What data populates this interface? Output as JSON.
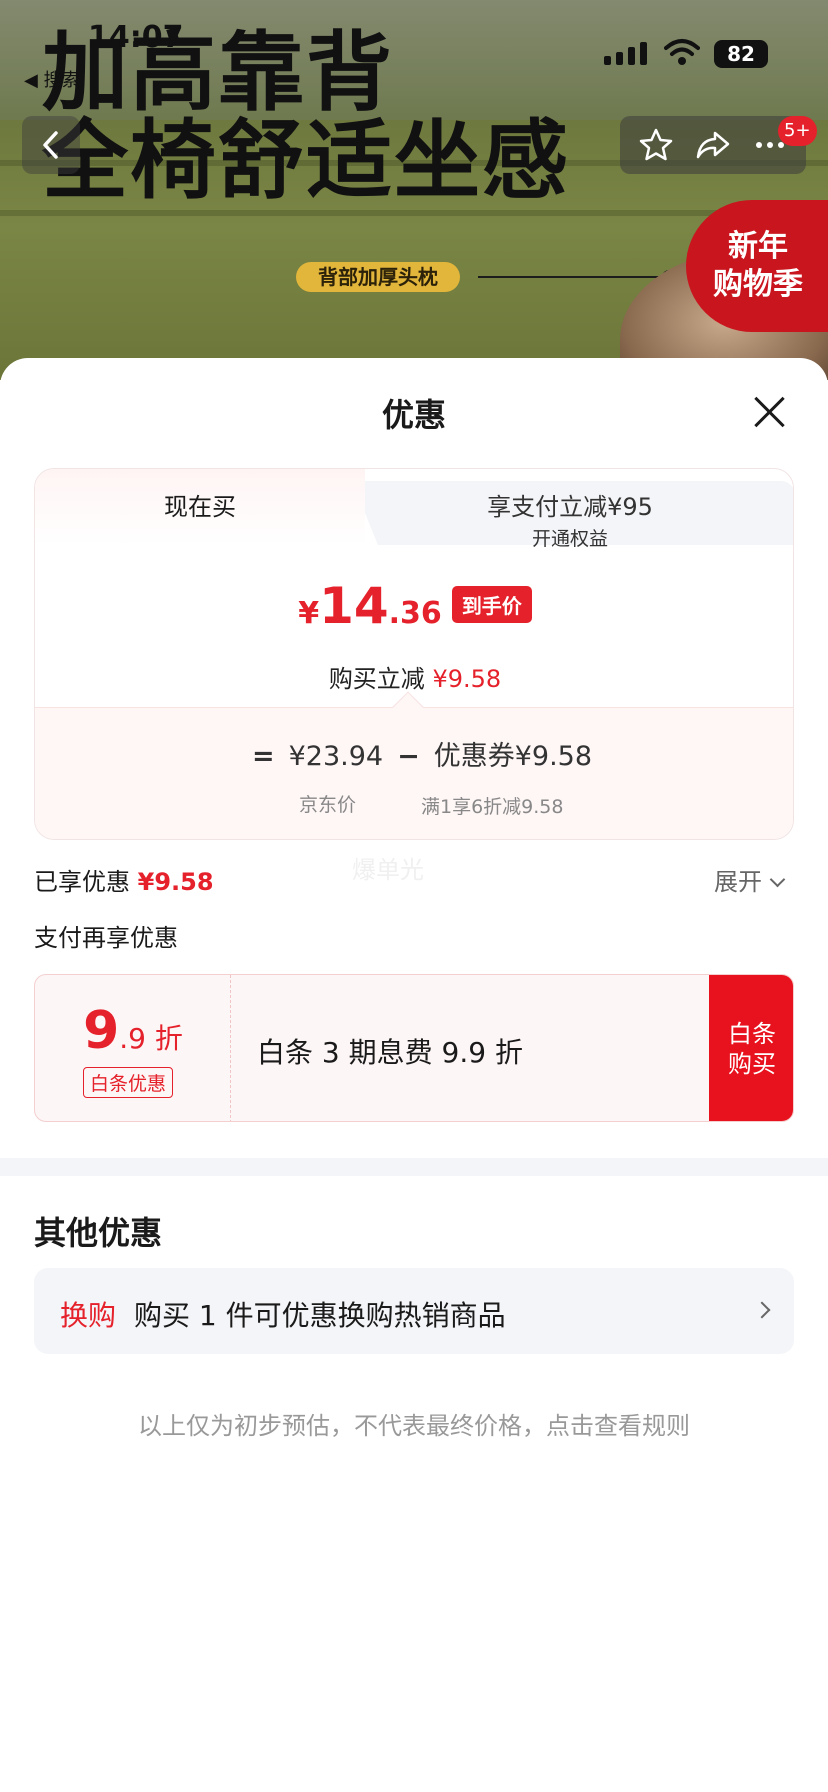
{
  "status_bar": {
    "time": "14:07",
    "back_label": "◀ 搜索",
    "battery": "82"
  },
  "banner": {
    "headline_line1": "加高靠背",
    "headline_line2": "全椅舒适坐感",
    "feature_pill": "背部加厚头枕",
    "promo_line1": "新年",
    "promo_line2": "购物季",
    "cart_badge": "5+"
  },
  "sheet": {
    "title": "优惠",
    "tabs": {
      "now": "现在买",
      "pay_title": "享支付立减¥95",
      "pay_sub": "开通权益"
    },
    "final_price": {
      "currency": "¥",
      "integer": "14",
      "decimal": ".36",
      "tag": "到手价"
    },
    "reduce": {
      "label": "购买立减",
      "amount": "¥9.58"
    },
    "formula": {
      "equals": "=",
      "jd_price": "¥23.94",
      "minus": "−",
      "coupon": "优惠券¥9.58",
      "jd_price_label": "京东价",
      "coupon_rule": "满1享6折减9.58"
    },
    "watermark": "爆单光",
    "enjoyed": {
      "label": "已享优惠",
      "amount": "¥9.58",
      "expand": "展开"
    },
    "pay_more_label": "支付再享优惠",
    "baitiao": {
      "rate_big": "9",
      "rate_small": ".9 折",
      "tag": "白条优惠",
      "desc": "白条 3 期息费 9.9 折",
      "button_line1": "白条",
      "button_line2": "购买"
    },
    "other": {
      "title": "其他优惠",
      "item_tag": "换购",
      "item_text": "购买 1 件可优惠换购热销商品"
    },
    "note": "以上仅为初步预估，不代表最终价格，点击查看规则"
  },
  "colors": {
    "accent_red": "#e5212b",
    "button_red": "#e8121e",
    "gray_bg": "#f4f5f8"
  },
  "icons": [
    "back-arrow-icon",
    "star-icon",
    "share-icon",
    "more-icon",
    "close-icon",
    "chevron-down-icon",
    "chevron-right-icon",
    "wifi-icon",
    "signal-icon"
  ]
}
